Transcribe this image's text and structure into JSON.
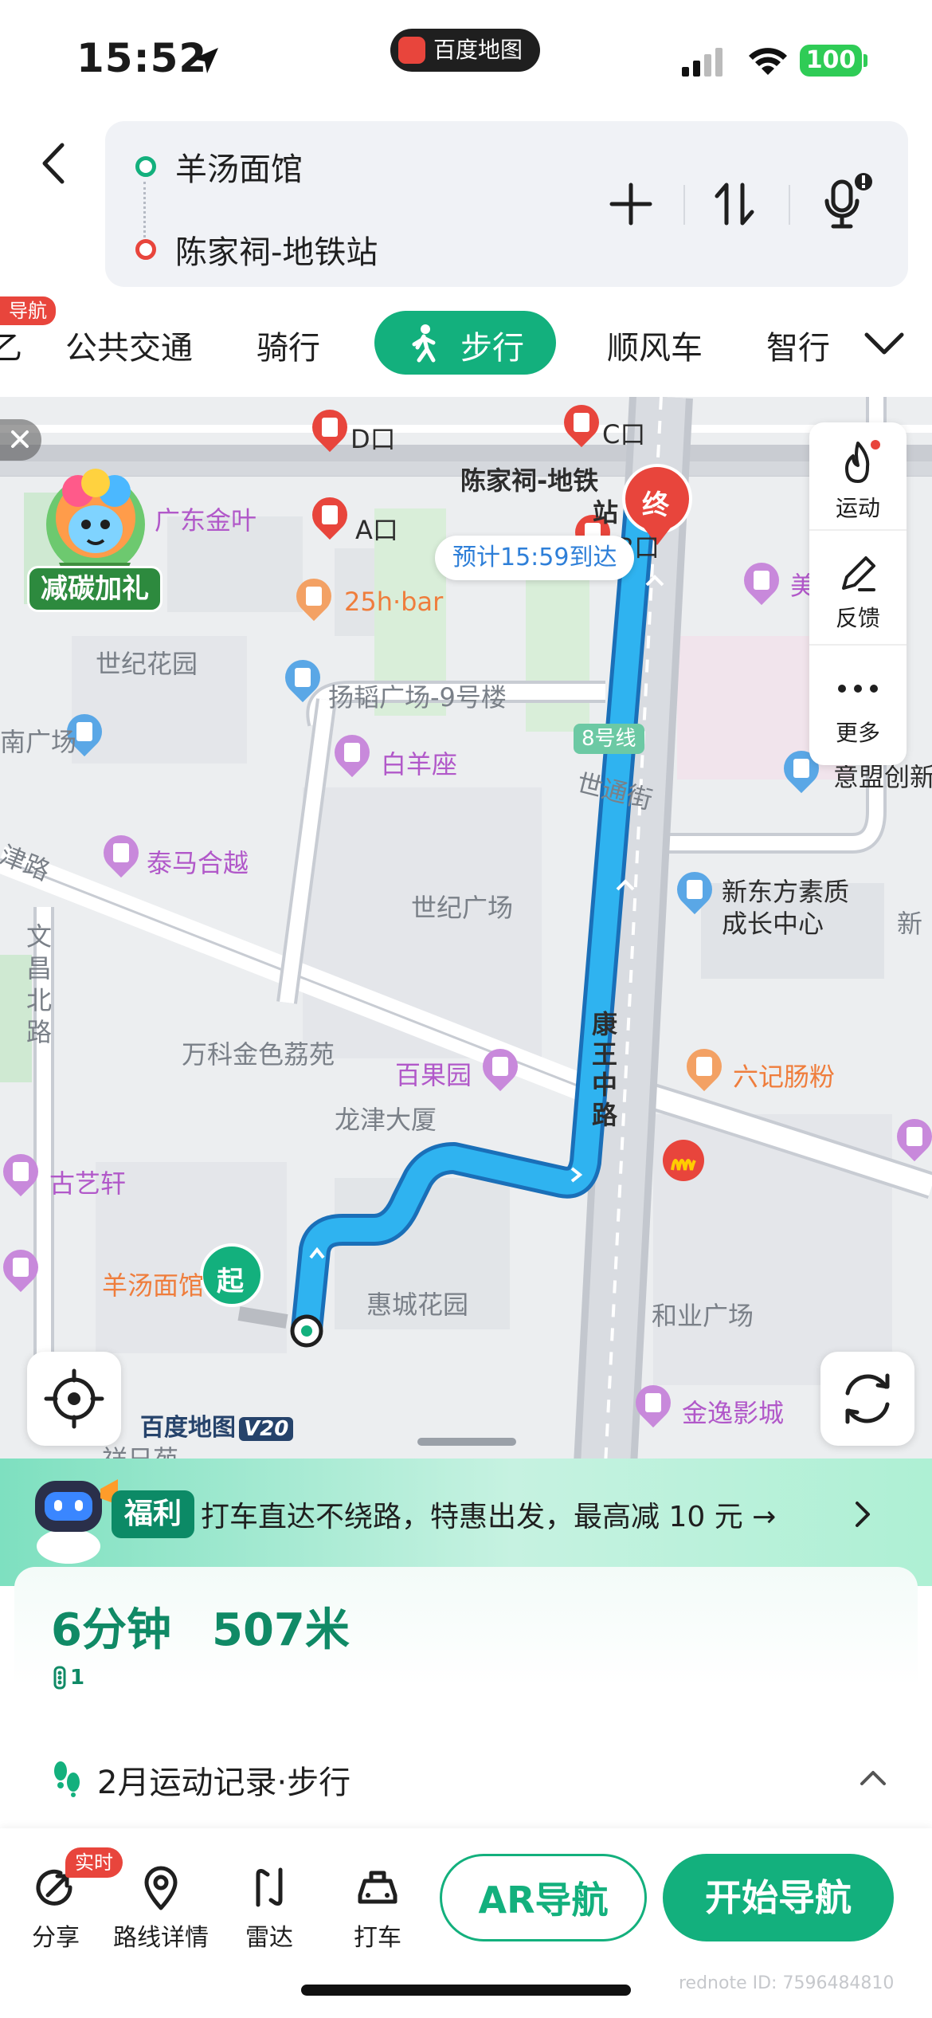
{
  "status_bar": {
    "time": "15:52",
    "app_name": "百度地图",
    "battery": "100",
    "icons": [
      "location-arrow-icon",
      "signal-icon",
      "wifi-icon",
      "battery-icon"
    ]
  },
  "route": {
    "start": "羊汤面馆",
    "end": "陈家祠-地铁站",
    "icons": [
      "back-icon",
      "add-waypoint-icon",
      "swap-icon",
      "voice-icon"
    ]
  },
  "tabs": {
    "cut_left_badge": "导航",
    "cut_left_label": "乙",
    "items": [
      "公共交通",
      "骑行",
      "步行",
      "顺风车",
      "智行"
    ],
    "active": "步行"
  },
  "map": {
    "eta": "预计15:59到达",
    "start_marker": "起",
    "end_marker": "终",
    "ad_label": "减碳加礼",
    "side_buttons": [
      "运动",
      "反馈",
      "更多"
    ],
    "watermark": "百度地图",
    "watermark_version": "V20",
    "labels": {
      "exit_d": "D口",
      "exit_c": "C口",
      "exit_a": "A口",
      "exit_b": "B口",
      "station": "陈家祠-地铁",
      "station_2": "站",
      "guangdong": "广东金叶",
      "bar": "25h·bar",
      "garden": "世纪花园",
      "plaza_9": "扬韬广场-9号楼",
      "plaza_left": "南广场",
      "baiyang": "白羊座",
      "line8": "8号线",
      "shitong": "世通街",
      "tianjin": "津路",
      "taima": "泰马合越",
      "century": "世纪广场",
      "neworiental": "新东方素质",
      "neworiental_2": "成长中心",
      "wenchang": "文昌北路",
      "vanke": "万科金色荔苑",
      "baiguo": "百果园",
      "longjin": "龙津大厦",
      "kangwang": "康王中路",
      "liuji": "六记肠粉",
      "guyixuan": "古艺轩",
      "restaurant": "羊汤面馆",
      "huicheng": "惠城花园",
      "heye": "和业广场",
      "jinyi": "金逸影城",
      "yixiang": "祥日苑",
      "mei": "美",
      "creative": "意盟创新",
      "xin": "新"
    }
  },
  "promo": {
    "tag": "福利",
    "text": "打车直达不绕路，特惠出发，最高减 10 元 →"
  },
  "summary": {
    "duration": "6分钟",
    "distance": "507米",
    "traffic_lights": "1"
  },
  "exercise": {
    "text": "2月运动记录·步行"
  },
  "bottom_bar": {
    "live_badge": "实时",
    "items": [
      "分享",
      "路线详情",
      "雷达",
      "打车"
    ],
    "ar_button": "AR导航",
    "start_button": "开始导航"
  },
  "watermark_note": "rednote ID: 7596484810",
  "colors": {
    "accent_green": "#13b07d",
    "route_blue": "#2a9be6",
    "end_red": "#e8453c"
  }
}
